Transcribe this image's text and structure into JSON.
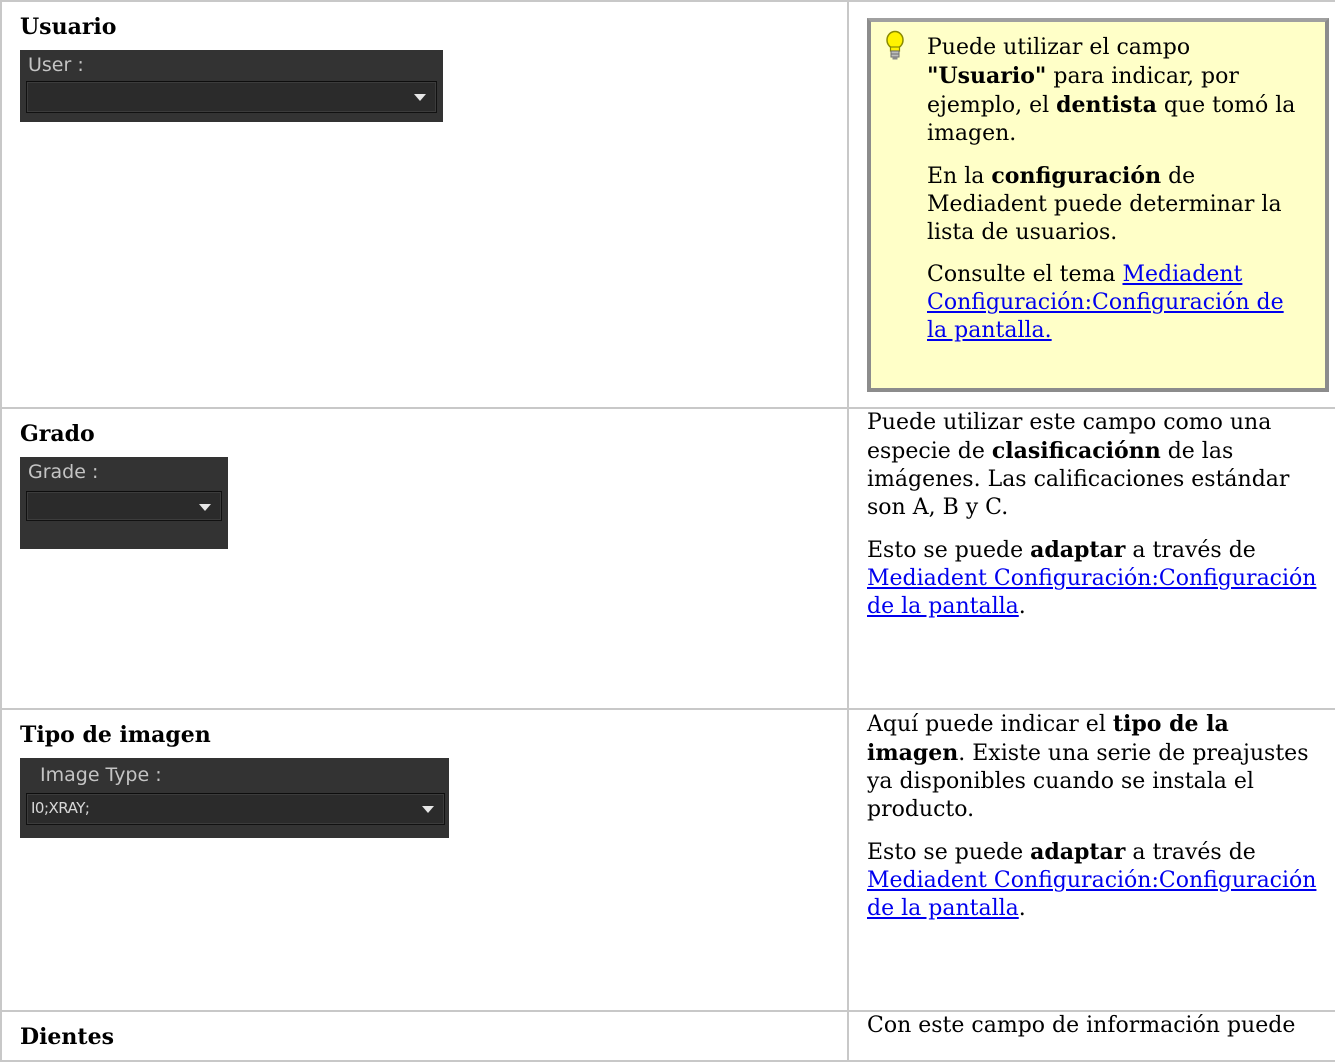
{
  "rows": [
    {
      "heading": "Usuario",
      "widget": {
        "label": "User :",
        "value": ""
      },
      "note": {
        "p1": {
          "a": "Puede utilizar el campo ",
          "b": "\"Usuario\"",
          "c": " para indicar, por ejemplo, el ",
          "d": "dentista",
          "e": " que tomó la imagen."
        },
        "p2": {
          "a": "En la ",
          "b": "configuración",
          "c": " de Mediadent puede determinar la lista de usuarios."
        },
        "p3": {
          "a": "Consulte el tema ",
          "link": "Mediadent Configuración:Configuración de la pantalla."
        }
      }
    },
    {
      "heading": "Grado",
      "widget": {
        "label": "Grade :",
        "value": ""
      },
      "p1": {
        "a": "Puede utilizar este campo como una especie de ",
        "b": "clasificaciónn",
        "c": " de las imágenes. Las calificaciones estándar son A, B y C."
      },
      "p2": {
        "a": "Esto se puede ",
        "b": "adaptar",
        "c": " a través de ",
        "link": "Mediadent Configuración:Configuración de la pantalla",
        "d": "."
      }
    },
    {
      "heading": "Tipo de imagen",
      "widget": {
        "label": "Image Type :",
        "value": "I0;XRAY;"
      },
      "p1": {
        "a": "Aquí puede indicar el ",
        "b": "tipo de la imagen",
        "c": ". Existe una serie de preajustes ya disponibles cuando se instala el producto."
      },
      "p2": {
        "a": "Esto se puede ",
        "b": "adaptar",
        "c": " a través de ",
        "link": "Mediadent Configuración:Configuración de la pantalla",
        "d": "."
      }
    },
    {
      "heading": "Dientes",
      "p1": {
        "a": "Con este campo de información puede"
      }
    }
  ],
  "colors": {
    "note_bg": "#ffffc8",
    "widget_bg": "#333333",
    "link": "#0000ee"
  },
  "icons": {
    "note": "lightbulb-icon",
    "dropdown": "triangle-down-icon"
  }
}
